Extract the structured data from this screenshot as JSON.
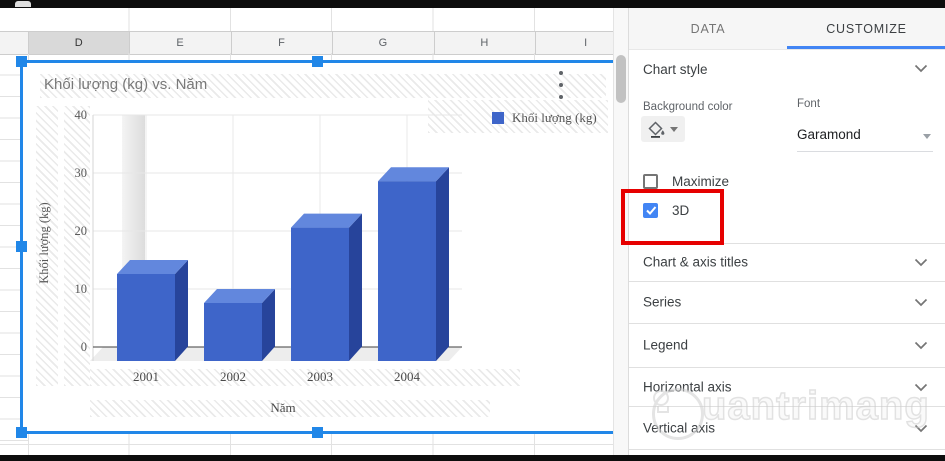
{
  "sheet": {
    "column_headers": [
      "D",
      "E",
      "F",
      "G",
      "H",
      "I"
    ],
    "selected_column": "D"
  },
  "chart": {
    "title": "Khối lượng (kg) vs. Năm",
    "legend": {
      "label": "Khối lượng (kg)",
      "swatch_color": "#3e65c9"
    },
    "menu_icon": "vertical-ellipsis-icon"
  },
  "chart_data": {
    "type": "bar",
    "is_3d": true,
    "title": "Khối lượng (kg) vs. Năm",
    "categories": [
      "2001",
      "2002",
      "2003",
      "2004"
    ],
    "series": [
      {
        "name": "Khối lượng (kg)",
        "values": [
          15,
          10,
          23,
          31
        ]
      }
    ],
    "xlabel": "Năm",
    "ylabel": "Khối lượng (kg)",
    "ylim": [
      0,
      40
    ],
    "yticks": [
      0,
      10,
      20,
      30,
      40
    ],
    "bar_color": "#3e65c9",
    "bar_top_color": "#6287dd",
    "bar_side_color": "#27449b",
    "grid": true,
    "legend_position": "top-right"
  },
  "panel": {
    "tabs": [
      {
        "label": "DATA",
        "active": false
      },
      {
        "label": "CUSTOMIZE",
        "active": true
      }
    ],
    "chart_style": {
      "title": "Chart style",
      "background_color_label": "Background color",
      "background_color_icon": "paint-bucket-icon",
      "font_label": "Font",
      "font_value": "Garamond",
      "checkboxes": [
        {
          "label": "Maximize",
          "checked": false
        },
        {
          "label": "3D",
          "checked": true,
          "highlighted": true
        }
      ]
    },
    "collapsed_sections": [
      "Chart & axis titles",
      "Series",
      "Legend",
      "Horizontal axis",
      "Vertical axis"
    ],
    "accent_color": "#4285f4",
    "highlight_color": "#e60000"
  },
  "selection": {
    "color": "#2187e8"
  },
  "watermark": {
    "text": "uantrimang",
    "logo": "lightbulb-icon"
  }
}
